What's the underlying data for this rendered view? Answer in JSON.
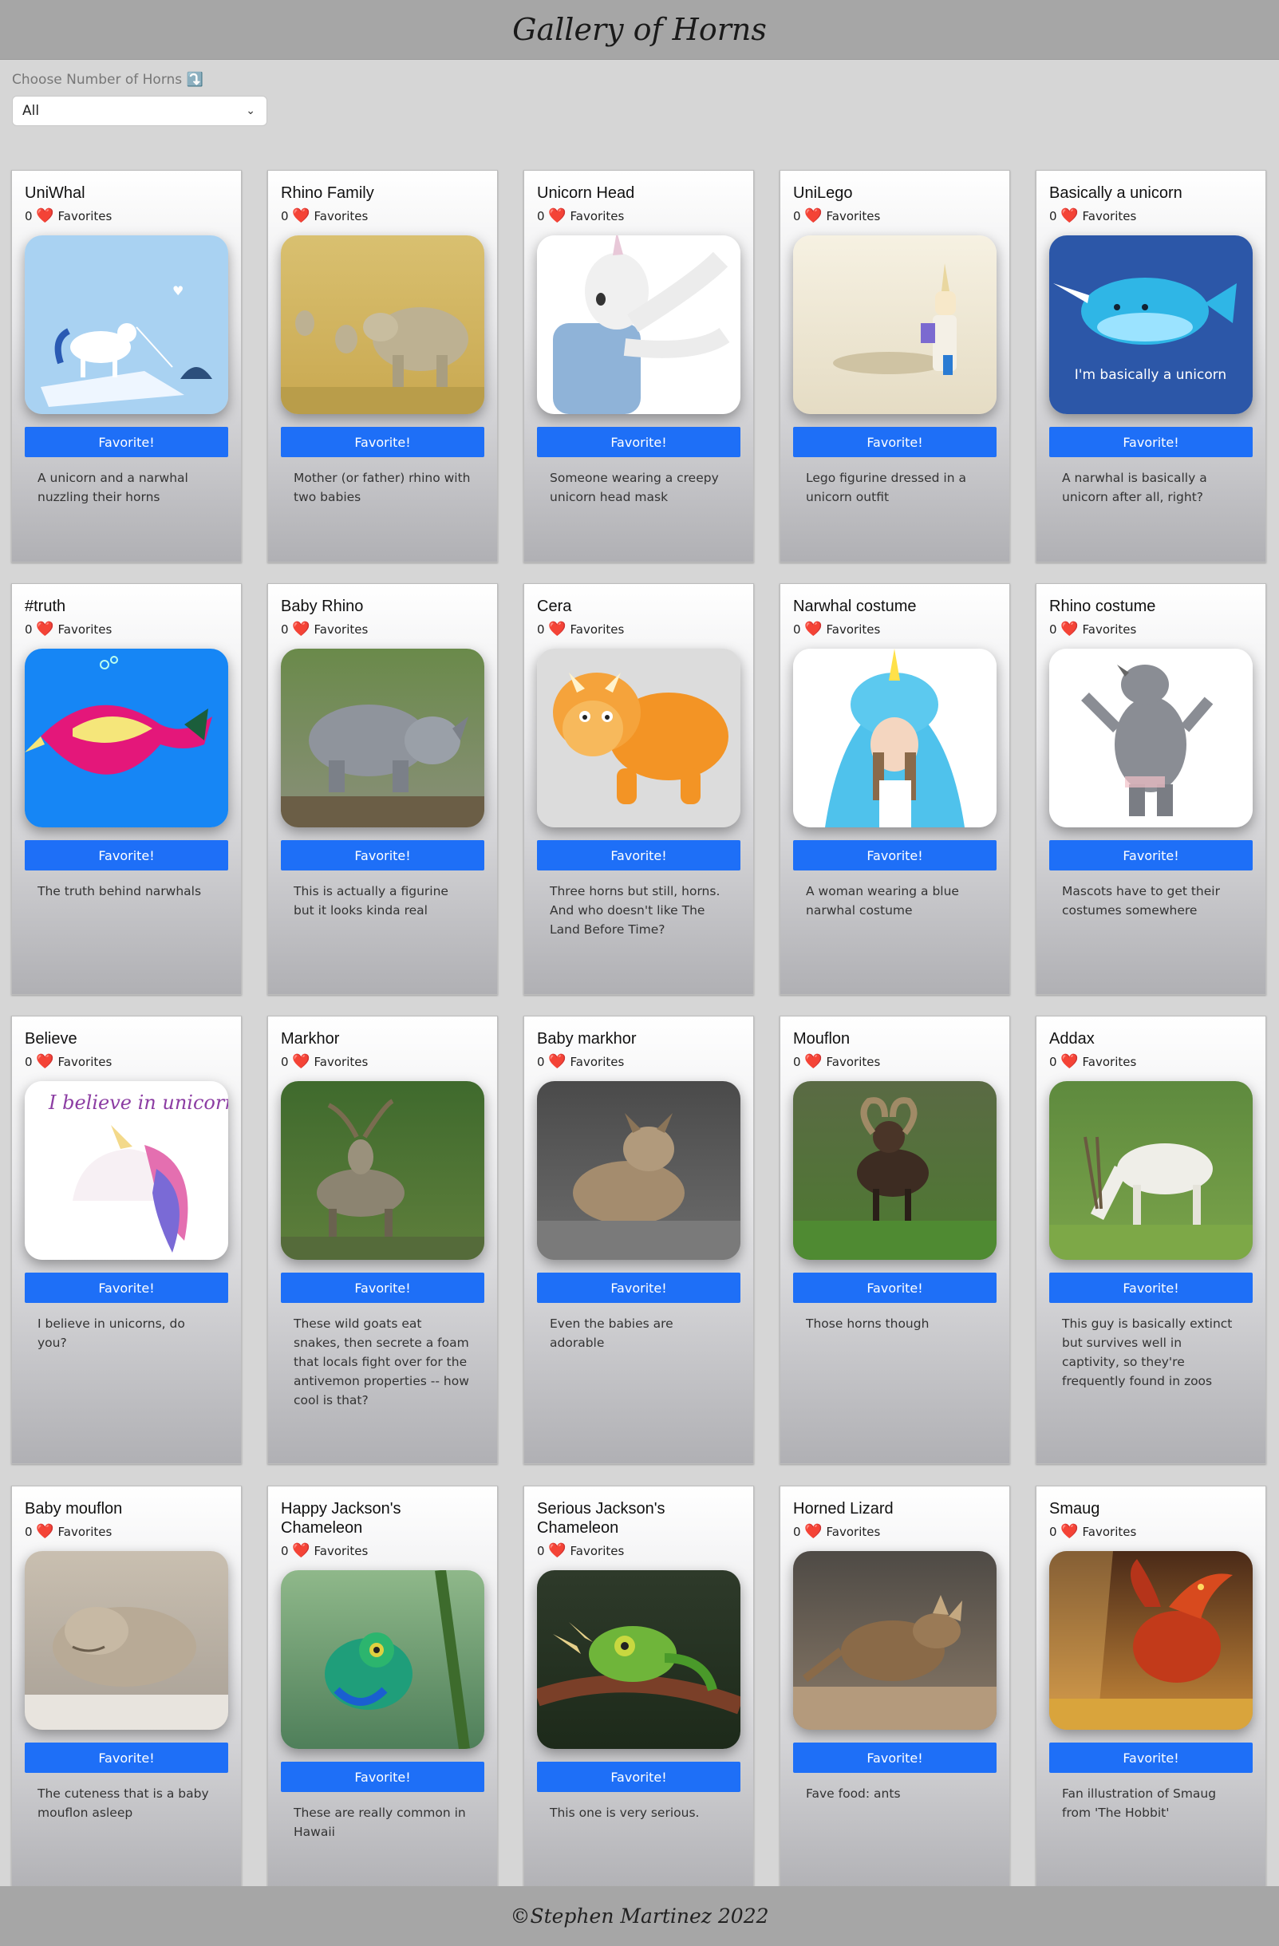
{
  "header": {
    "title": "Gallery of Horns"
  },
  "filter": {
    "label": "Choose Number of Horns ⤵️",
    "selected": "All"
  },
  "common": {
    "fav_button": "Favorite!",
    "favorites_suffix": "Favorites"
  },
  "cards": [
    {
      "title": "UniWhal",
      "count": "0",
      "desc": "A unicorn and a narwhal nuzzling their horns",
      "img": "unicorn-narwhal-art"
    },
    {
      "title": "Rhino Family",
      "count": "0",
      "desc": "Mother (or father) rhino with two babies",
      "img": "rhino-family-photo"
    },
    {
      "title": "Unicorn Head",
      "count": "0",
      "desc": "Someone wearing a creepy unicorn head mask",
      "img": "unicorn-mask-photo"
    },
    {
      "title": "UniLego",
      "count": "0",
      "desc": "Lego figurine dressed in a unicorn outfit",
      "img": "lego-unicorn-photo"
    },
    {
      "title": "Basically a unicorn",
      "count": "0",
      "desc": "A narwhal is basically a unicorn after all, right?",
      "img": "narwhal-cartoon",
      "img_text": "I'm basically a unicorn"
    },
    {
      "title": "#truth",
      "count": "0",
      "desc": "The truth behind narwhals",
      "img": "narwhal-truth-art"
    },
    {
      "title": "Baby Rhino",
      "count": "0",
      "desc": "This is actually a figurine but it looks kinda real",
      "img": "baby-rhino-photo"
    },
    {
      "title": "Cera",
      "count": "0",
      "desc": "Three horns but still, horns. And who doesn't like The Land Before Time?",
      "img": "cera-cartoon"
    },
    {
      "title": "Narwhal costume",
      "count": "0",
      "desc": "A woman wearing a blue narwhal costume",
      "img": "narwhal-costume-photo"
    },
    {
      "title": "Rhino costume",
      "count": "0",
      "desc": "Mascots have to get their costumes somewhere",
      "img": "rhino-mascot-photo"
    },
    {
      "title": "Believe",
      "count": "0",
      "desc": "I believe in unicorns, do you?",
      "img": "believe-unicorn-art",
      "img_text": "I believe in unicorns"
    },
    {
      "title": "Markhor",
      "count": "0",
      "desc": "These wild goats eat snakes, then secrete a foam that locals fight over for the antivemon properties -- how cool is that?",
      "img": "markhor-photo"
    },
    {
      "title": "Baby markhor",
      "count": "0",
      "desc": "Even the babies are adorable",
      "img": "baby-markhor-photo"
    },
    {
      "title": "Mouflon",
      "count": "0",
      "desc": "Those horns though",
      "img": "mouflon-photo"
    },
    {
      "title": "Addax",
      "count": "0",
      "desc": "This guy is basically extinct but survives well in captivity, so they're frequently found in zoos",
      "img": "addax-photo"
    },
    {
      "title": "Baby mouflon",
      "count": "0",
      "desc": "The cuteness that is a baby mouflon asleep",
      "img": "baby-mouflon-photo"
    },
    {
      "title": "Happy Jackson's Chameleon",
      "count": "0",
      "desc": "These are really common in Hawaii",
      "img": "chameleon-happy-photo"
    },
    {
      "title": "Serious Jackson's Chameleon",
      "count": "0",
      "desc": "This one is very serious.",
      "img": "chameleon-serious-photo"
    },
    {
      "title": "Horned Lizard",
      "count": "0",
      "desc": "Fave food: ants",
      "img": "horned-lizard-photo"
    },
    {
      "title": "Smaug",
      "count": "0",
      "desc": "Fan illustration of Smaug from 'The Hobbit'",
      "img": "smaug-illustration"
    }
  ],
  "footer": {
    "text": "©Stephen Martinez 2022"
  }
}
